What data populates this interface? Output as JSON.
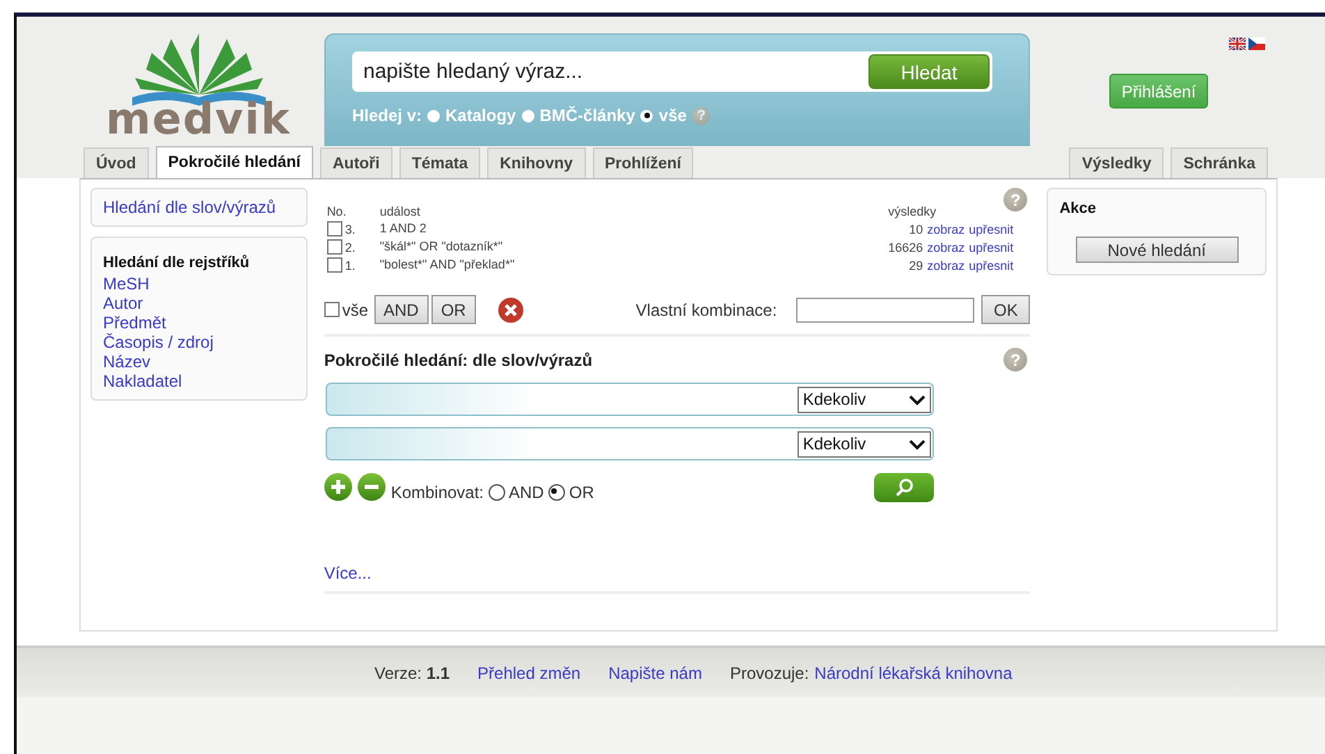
{
  "header": {
    "logo": "medvik",
    "search": {
      "placeholder": "napište hledaný výraz...",
      "button": "Hledat",
      "scope_label": "Hledej v:",
      "help": "?",
      "scopes": [
        {
          "label": "Katalogy",
          "selected": false
        },
        {
          "label": "BMČ-články",
          "selected": false
        },
        {
          "label": "vše",
          "selected": true
        }
      ]
    },
    "login": "Přihlášení"
  },
  "tabs": [
    {
      "label": "Úvod",
      "selected": false
    },
    {
      "label": "Pokročilé hledání",
      "selected": true
    },
    {
      "label": "Autoři",
      "selected": false
    },
    {
      "label": "Témata",
      "selected": false
    },
    {
      "label": "Knihovny",
      "selected": false
    },
    {
      "label": "Prohlížení",
      "selected": false
    }
  ],
  "right_tabs": [
    {
      "label": "Výsledky",
      "selected": false
    },
    {
      "label": "Schránka",
      "selected": false
    }
  ],
  "sidebar": {
    "primary_link": "Hledání dle slov/výrazů",
    "index_heading": "Hledání dle rejstříků",
    "index_links": [
      "MeSH",
      "Autor",
      "Předmět",
      "Časopis / zdroj",
      "Název",
      "Nakladatel"
    ]
  },
  "history": {
    "help": "?",
    "columns": {
      "no": "No.",
      "event": "událost",
      "results": "výsledky"
    },
    "rows": [
      {
        "checked": false,
        "no": "3.",
        "query": "1 AND 2",
        "count": "10",
        "show": "zobraz",
        "refine": "upřesnit"
      },
      {
        "checked": false,
        "no": "2.",
        "query": "\"škál*\" OR \"dotazník*\"",
        "count": "16626",
        "show": "zobraz",
        "refine": "upřesnit"
      },
      {
        "checked": false,
        "no": "1.",
        "query": "\"bolest*\" AND \"překlad*\"",
        "count": "29",
        "show": "zobraz",
        "refine": "upřesnit"
      }
    ],
    "select_all": {
      "label": "vše",
      "checked": false
    },
    "buttons": [
      "AND",
      "OR"
    ],
    "custom_label": "Vlastní kombinace:",
    "ok": "OK"
  },
  "advanced": {
    "title": "Pokročilé hledání: dle slov/výrazů",
    "help": "?",
    "rows": [
      {
        "field": "Kdekoliv"
      },
      {
        "field": "Kdekoliv"
      }
    ],
    "combine_label": "Kombinovat:",
    "combine": [
      {
        "label": "AND",
        "selected": false
      },
      {
        "label": "OR",
        "selected": true
      }
    ],
    "more": "Více..."
  },
  "actions": {
    "title": "Akce",
    "button": "Nové hledání"
  },
  "footer": {
    "version_label": "Verze:",
    "version": "1.1",
    "links": [
      "Přehled změn",
      "Napište nám"
    ],
    "operator_label": "Provozuje:",
    "operator": "Národní lékařská knihovna"
  }
}
